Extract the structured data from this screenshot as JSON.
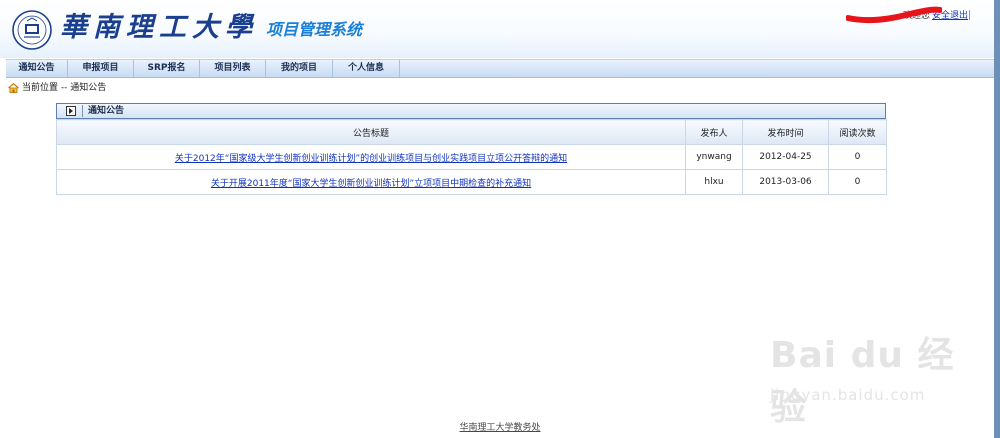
{
  "header": {
    "school_name": "華南理工大學",
    "system_name": "项目管理系统",
    "user_greeting": "欢迎您",
    "logout_label": "安全退出"
  },
  "nav": {
    "items": [
      {
        "label": "通知公告"
      },
      {
        "label": "申报项目"
      },
      {
        "label": "SRP报名"
      },
      {
        "label": "项目列表"
      },
      {
        "label": "我的项目"
      },
      {
        "label": "个人信息"
      }
    ]
  },
  "breadcrumb": {
    "text": "当前位置 -- 通知公告"
  },
  "panel": {
    "title": "通知公告",
    "columns": [
      "公告标题",
      "发布人",
      "发布时间",
      "阅读次数"
    ],
    "rows": [
      {
        "title": "关于2012年“国家级大学生创新创业训练计划”的创业训练项目与创业实践项目立项公开答辩的通知",
        "publisher": "ynwang",
        "date": "2012-04-25",
        "reads": "0"
      },
      {
        "title": "关于开展2011年度“国家大学生创新创业训练计划”立项项目中期检查的补充通知",
        "publisher": "hlxu",
        "date": "2013-03-06",
        "reads": "0"
      }
    ]
  },
  "footer": {
    "link": "华南理工大学教务处"
  },
  "watermark": {
    "main": "Bai du 经验",
    "sub": "jingyan.baidu.com"
  },
  "colors": {
    "brand_blue": "#1b3f8f",
    "system_title": "#1a7fd6",
    "link": "#1033c0",
    "nav_bg": "#c8dcf3",
    "redaction": "#e8141c"
  }
}
